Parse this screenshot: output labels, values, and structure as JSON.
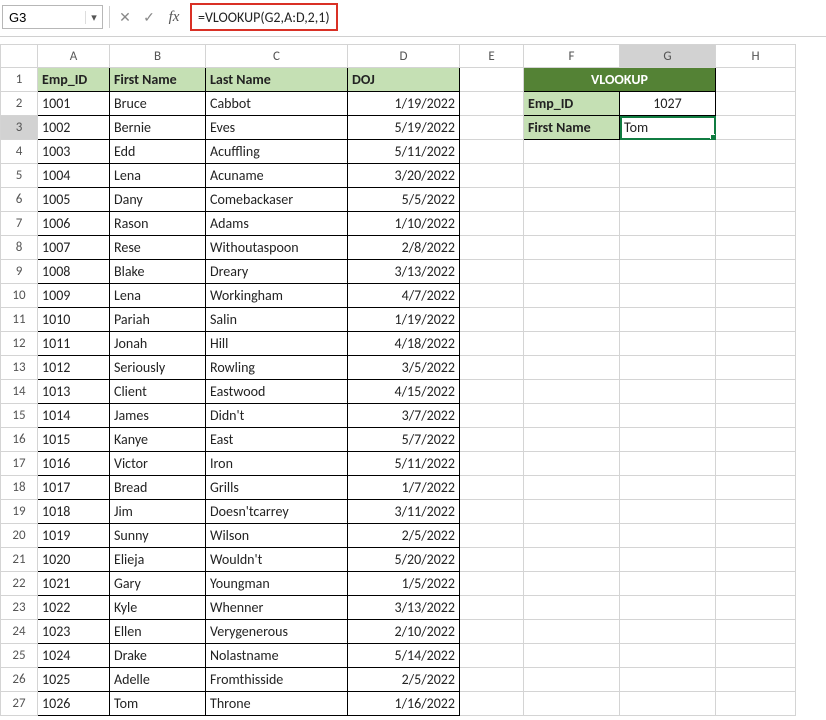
{
  "namebox": "G3",
  "fx_cancel": "✕",
  "fx_confirm": "✓",
  "fx_label": "fx",
  "formula": "=VLOOKUP(G2,A:D,2,1)",
  "columns": [
    "A",
    "B",
    "C",
    "D",
    "E",
    "F",
    "G",
    "H"
  ],
  "rows": [
    "1",
    "2",
    "3",
    "4",
    "5",
    "6",
    "7",
    "8",
    "9",
    "10",
    "11",
    "12",
    "13",
    "14",
    "15",
    "16",
    "17",
    "18",
    "19",
    "20",
    "21",
    "22",
    "23",
    "24",
    "25",
    "26",
    "27"
  ],
  "headers": {
    "a": "Emp_ID",
    "b": "First Name",
    "c": "Last Name",
    "d": "DOJ"
  },
  "vlookup": {
    "title": "VLOOKUP",
    "id_lbl": "Emp_ID",
    "id_val": "1027",
    "fn_lbl": "First Name",
    "fn_val": "Tom"
  },
  "table": [
    {
      "id": "1001",
      "fn": "Bruce",
      "ln": "Cabbot",
      "doj": "1/19/2022"
    },
    {
      "id": "1002",
      "fn": "Bernie",
      "ln": "Eves",
      "doj": "5/19/2022"
    },
    {
      "id": "1003",
      "fn": "Edd",
      "ln": "Acuffling",
      "doj": "5/11/2022"
    },
    {
      "id": "1004",
      "fn": "Lena",
      "ln": "Acuname",
      "doj": "3/20/2022"
    },
    {
      "id": "1005",
      "fn": "Dany",
      "ln": "Comebackaser",
      "doj": "5/5/2022"
    },
    {
      "id": "1006",
      "fn": "Rason",
      "ln": "Adams",
      "doj": "1/10/2022"
    },
    {
      "id": "1007",
      "fn": "Rese",
      "ln": "Withoutaspoon",
      "doj": "2/8/2022"
    },
    {
      "id": "1008",
      "fn": "Blake",
      "ln": "Dreary",
      "doj": "3/13/2022"
    },
    {
      "id": "1009",
      "fn": "Lena",
      "ln": "Workingham",
      "doj": "4/7/2022"
    },
    {
      "id": "1010",
      "fn": "Pariah",
      "ln": "Salin",
      "doj": "1/19/2022"
    },
    {
      "id": "1011",
      "fn": "Jonah",
      "ln": "Hill",
      "doj": "4/18/2022"
    },
    {
      "id": "1012",
      "fn": "Seriously",
      "ln": "Rowling",
      "doj": "3/5/2022"
    },
    {
      "id": "1013",
      "fn": "Client",
      "ln": "Eastwood",
      "doj": "4/15/2022"
    },
    {
      "id": "1014",
      "fn": "James",
      "ln": "Didn't",
      "doj": "3/7/2022"
    },
    {
      "id": "1015",
      "fn": "Kanye",
      "ln": "East",
      "doj": "5/7/2022"
    },
    {
      "id": "1016",
      "fn": "Victor",
      "ln": "Iron",
      "doj": "5/11/2022"
    },
    {
      "id": "1017",
      "fn": "Bread",
      "ln": "Grills",
      "doj": "1/7/2022"
    },
    {
      "id": "1018",
      "fn": "Jim",
      "ln": "Doesn'tcarrey",
      "doj": "3/11/2022"
    },
    {
      "id": "1019",
      "fn": "Sunny",
      "ln": "Wilson",
      "doj": "2/5/2022"
    },
    {
      "id": "1020",
      "fn": "Elieja",
      "ln": "Wouldn't",
      "doj": "5/20/2022"
    },
    {
      "id": "1021",
      "fn": "Gary",
      "ln": "Youngman",
      "doj": "1/5/2022"
    },
    {
      "id": "1022",
      "fn": "Kyle",
      "ln": "Whenner",
      "doj": "3/13/2022"
    },
    {
      "id": "1023",
      "fn": "Ellen",
      "ln": "Verygenerous",
      "doj": "2/10/2022"
    },
    {
      "id": "1024",
      "fn": "Drake",
      "ln": "Nolastname",
      "doj": "5/14/2022"
    },
    {
      "id": "1025",
      "fn": "Adelle",
      "ln": "Fromthisside",
      "doj": "2/5/2022"
    },
    {
      "id": "1026",
      "fn": "Tom",
      "ln": "Throne",
      "doj": "1/16/2022"
    }
  ]
}
